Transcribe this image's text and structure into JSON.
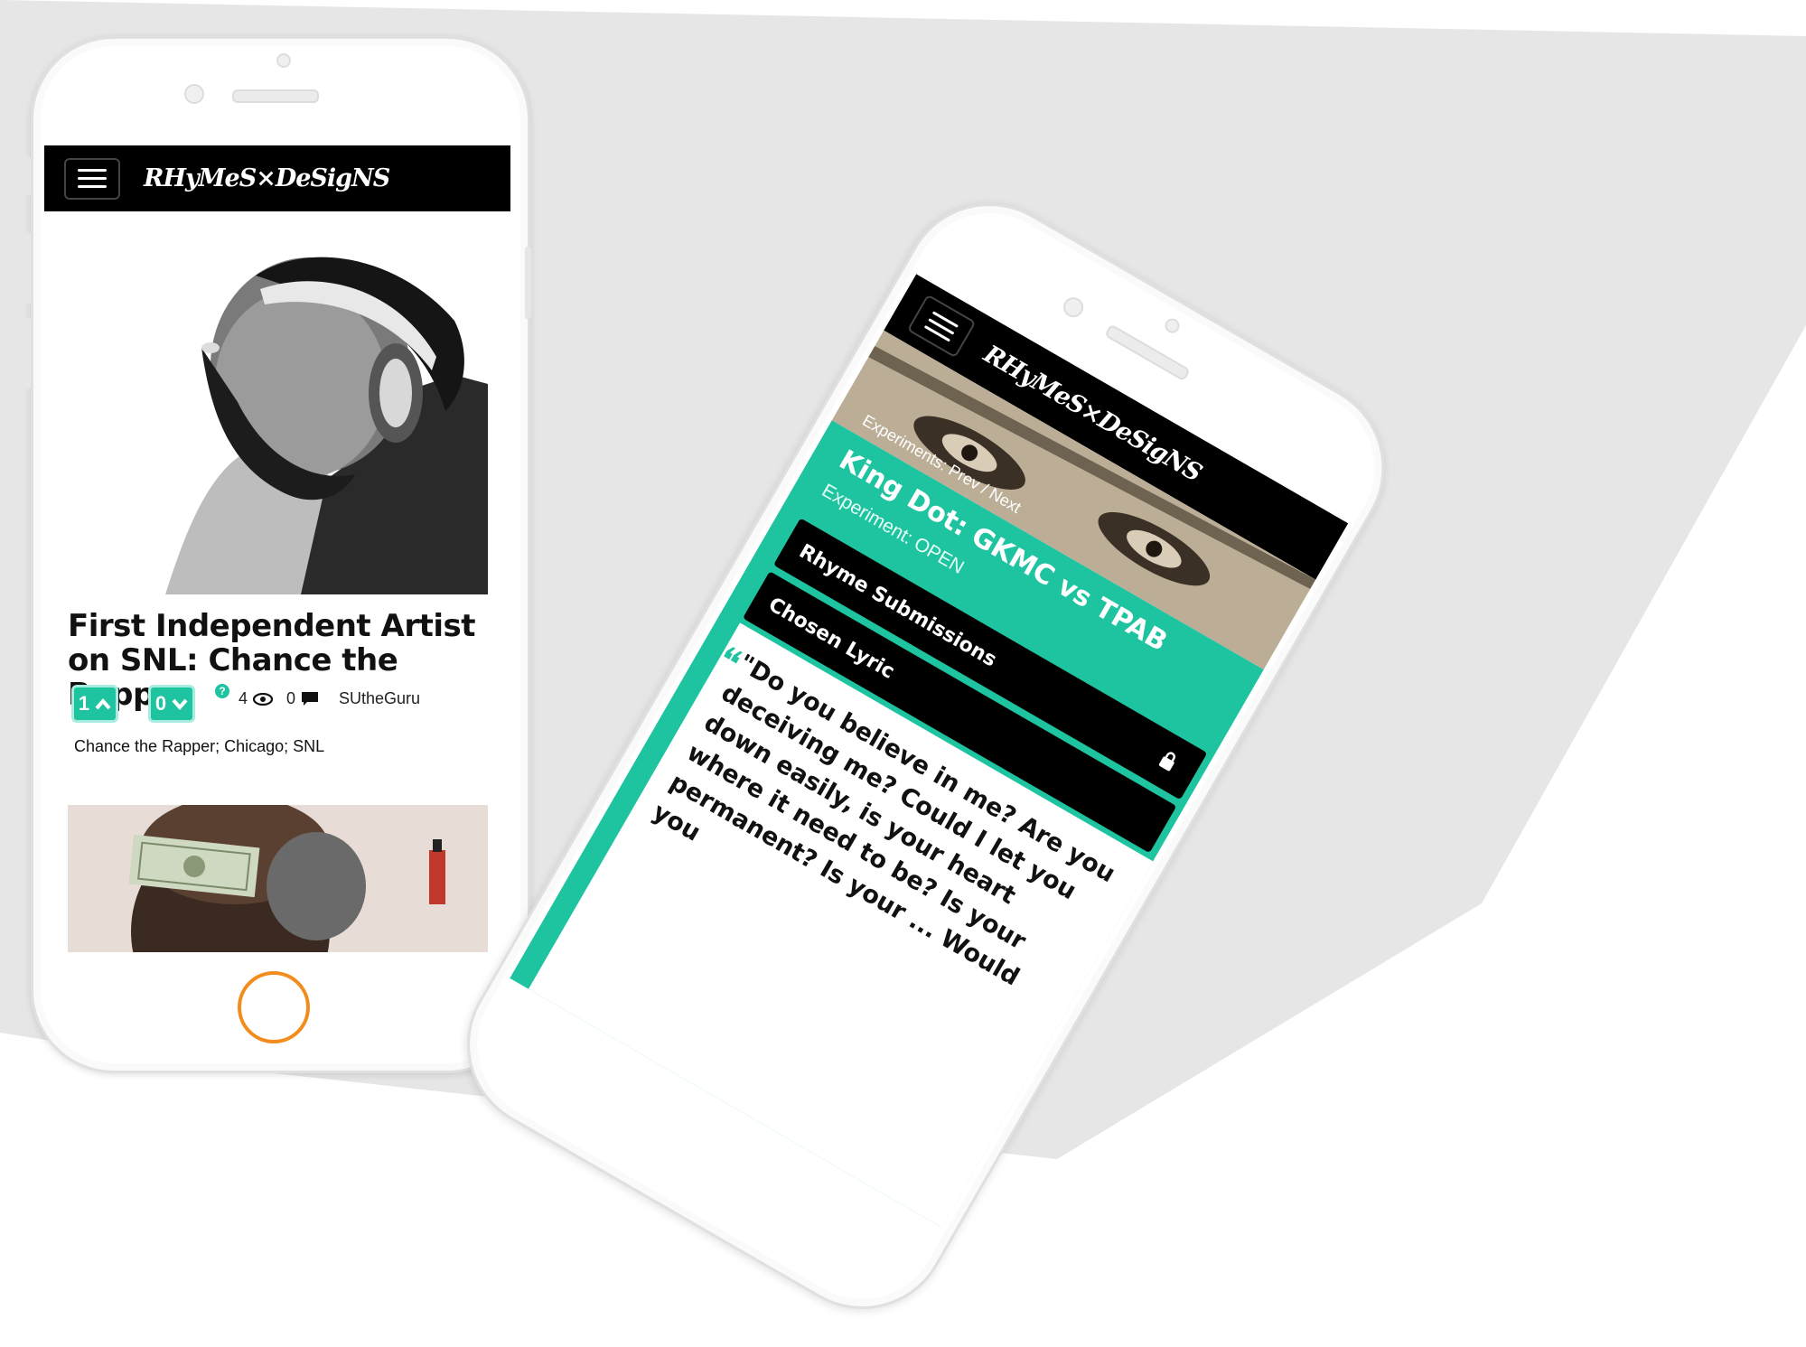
{
  "brand": {
    "logo_text": "RHyMeS×DeSigNS",
    "accent_color": "#1ec4a0",
    "home_button_color": "#f28c1c"
  },
  "phone1": {
    "menu_icon": "hamburger-icon",
    "article": {
      "title": "First Independent Artist on SNL: Chance the Rapper",
      "upvotes": "1",
      "downvotes": "0",
      "help_mark": "?",
      "views": "4",
      "comments": "0",
      "author": "SUtheGuru",
      "tags": "Chance the Rapper; Chicago; SNL"
    }
  },
  "phone2": {
    "experiments_label": "Experiments:",
    "prev_next": "Prev / Next",
    "title": "King Dot: GKMC vs TPAB",
    "status": "Experiment: OPEN",
    "tabs": [
      "Rhyme Submissions",
      "Chosen Lyric"
    ],
    "lyric": "\"Do you believe in me? Are you deceiving me? Could I let you down easily, is your heart where it need to be? Is your permanent? Is your ... Would you"
  }
}
